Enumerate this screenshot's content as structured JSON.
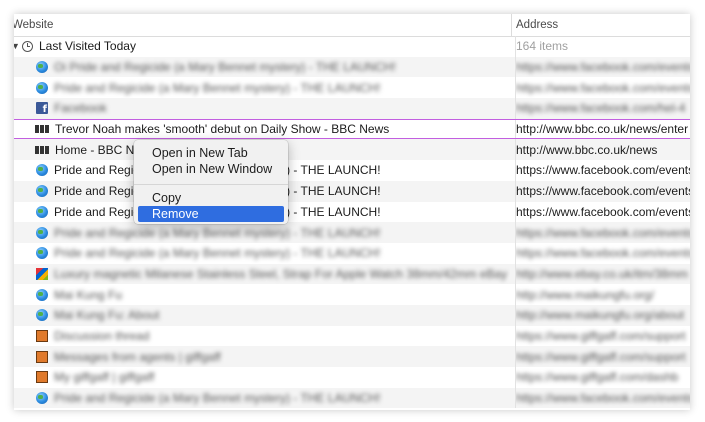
{
  "header": {
    "website": "Website",
    "address": "Address"
  },
  "group": {
    "title": "Last Visited Today",
    "count": "164 items"
  },
  "rows": [
    {
      "icon": "globe-icon",
      "site": "Oi Pride and Regicide (a Mary Bennet mystery) - THE LAUNCH!",
      "address": "https://www.facebook.com/events",
      "blurred": true
    },
    {
      "icon": "globe-icon",
      "site": "Pride and Regicide (a Mary Bennet mystery) - THE LAUNCH!",
      "address": "https://www.facebook.com/events",
      "blurred": true
    },
    {
      "icon": "facebook-icon",
      "site": "Facebook",
      "address": "https://www.facebook.com/hel-4",
      "blurred": true
    },
    {
      "icon": "bbc-icon",
      "site": "Trevor Noah makes 'smooth' debut on Daily Show - BBC News",
      "address": "http://www.bbc.co.uk/news/enter",
      "blurred": false,
      "selected": true
    },
    {
      "icon": "bbc-icon",
      "site": "Home - BBC News",
      "address": "http://www.bbc.co.uk/news",
      "blurred": false
    },
    {
      "icon": "globe-icon",
      "site": "Pride and Regicide (a Mary Bennet mystery) - THE LAUNCH!",
      "address": "https://www.facebook.com/events",
      "blurred": false
    },
    {
      "icon": "globe-icon",
      "site": "Pride and Regicide (a Mary Bennet mystery) - THE LAUNCH!",
      "address": "https://www.facebook.com/events",
      "blurred": false
    },
    {
      "icon": "globe-icon",
      "site": "Pride and Regicide (a Mary Bennet mystery) - THE LAUNCH!",
      "address": "https://www.facebook.com/events",
      "blurred": false
    },
    {
      "icon": "globe-icon",
      "site": "Pride and Regicide (a Mary Bennet mystery) - THE LAUNCH!",
      "address": "https://www.facebook.com/events",
      "blurred": true
    },
    {
      "icon": "globe-icon",
      "site": "Pride and Regicide (a Mary Bennet mystery) - THE LAUNCH!",
      "address": "https://www.facebook.com/events",
      "blurred": true
    },
    {
      "icon": "ebay-icon",
      "site": "Luxury magnetic Milanese Stainless Steel, Strap For Apple Watch 38mm/42mm eBay",
      "address": "http://www.ebay.co.uk/itm/38mm",
      "blurred": true
    },
    {
      "icon": "globe-icon",
      "site": "Mai Kung Fu",
      "address": "http://www.maikungfu.org/",
      "blurred": true
    },
    {
      "icon": "globe-icon",
      "site": "Mai Kung Fu: About",
      "address": "http://www.maikungfu.org/about",
      "blurred": true
    },
    {
      "icon": "giffgaff-icon",
      "site": "Discussion thread",
      "address": "https://www.giffgaff.com/support",
      "blurred": true
    },
    {
      "icon": "giffgaff-icon",
      "site": "Messages from agents | giffgaff",
      "address": "https://www.giffgaff.com/support",
      "blurred": true
    },
    {
      "icon": "giffgaff-icon",
      "site": "My giffgaff | giffgaff",
      "address": "https://www.giffgaff.com/dashb",
      "blurred": true
    },
    {
      "icon": "globe-icon",
      "site": "Pride and Regicide (a Mary Bennet mystery) - THE LAUNCH!",
      "address": "https://www.facebook.com/events",
      "blurred": true
    }
  ],
  "context_menu": {
    "items": [
      "Open in New Tab",
      "Open in New Window",
      "Copy",
      "Remove"
    ],
    "highlighted": "Remove"
  },
  "colors": {
    "selection_outline": "#c25ee0",
    "menu_highlight": "#2f6de0"
  }
}
